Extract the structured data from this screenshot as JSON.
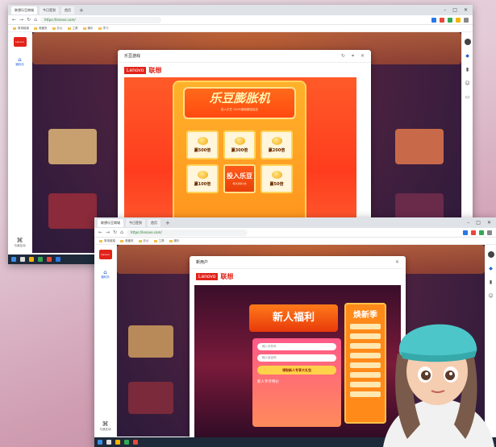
{
  "window1": {
    "tabs": [
      "联想乐豆商城",
      "今日签到",
      "首页"
    ],
    "url": "https://lenovo.com/",
    "bookmarks": [
      "常用链接",
      "收藏夹",
      "办公",
      "工具",
      "娱乐",
      "学习"
    ],
    "sidebar": {
      "nav_label": "福利页",
      "bottom_label": "与我互动"
    },
    "miniapp": {
      "title": "乐豆游戏",
      "brand_en": "Lenovo",
      "brand_cn": "联想",
      "promo": {
        "machine_title": "乐豆膨胀机",
        "machine_subtitle": "投入乐豆 100%膨胀翻倍返还",
        "slots": [
          "赢500倍",
          "赢300倍",
          "赢200倍",
          "赢100倍",
          "赢50倍"
        ],
        "insert_label": "投入乐豆",
        "insert_sub": "每次消耗1枚"
      }
    }
  },
  "window2": {
    "tabs": [
      "联想乐豆商城",
      "今日签到",
      "首页"
    ],
    "url": "https://lenovo.com/",
    "bookmarks": [
      "常用链接",
      "收藏夹",
      "办公",
      "工具",
      "娱乐"
    ],
    "sidebar": {
      "nav_label": "福利页",
      "bottom_label": "与我互动"
    },
    "miniapp": {
      "title": "新用户",
      "brand_en": "Lenovo",
      "brand_cn": "联想",
      "promo": {
        "banner": "新人福利",
        "tag": "焕新季",
        "field1": "输入手机号",
        "field2": "输入验证码",
        "button": "领取新人专享大礼包",
        "footer": "新人专享特价"
      }
    }
  },
  "colors": {
    "brand_red": "#e2231a",
    "accent_blue": "#1f5fd6"
  }
}
